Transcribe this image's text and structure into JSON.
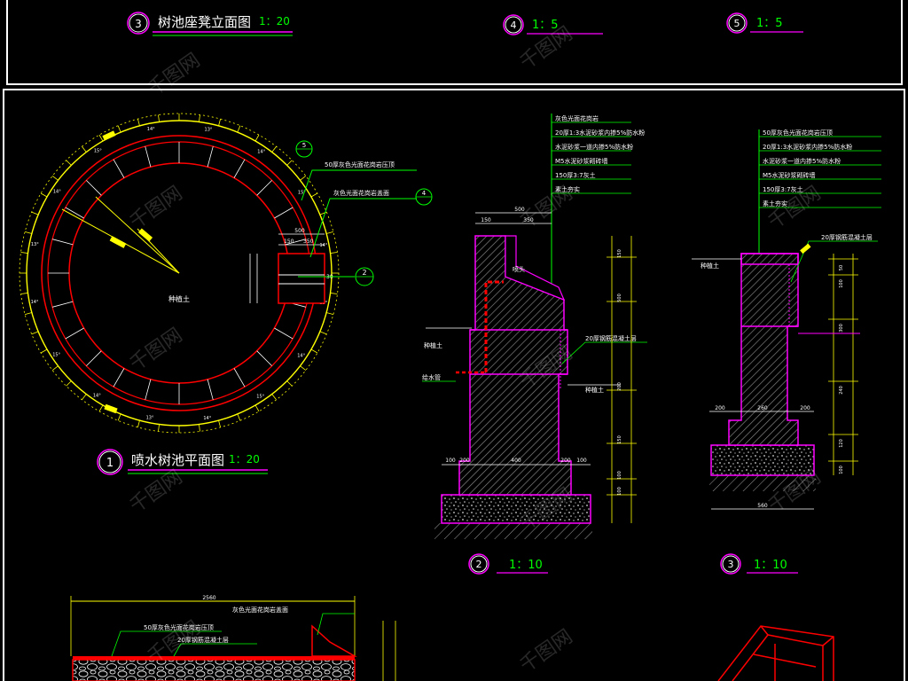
{
  "colors": {
    "background": "#000000",
    "frame": "#ffffff",
    "yellow": "#ffff00",
    "red": "#ff0000",
    "green": "#00ff00",
    "magenta": "#ff00ff",
    "cyan": "#00ffff",
    "white": "#ffffff",
    "hatch": "#8a8a8a"
  },
  "titles": {
    "top_left": {
      "number": "3",
      "text": "树池座凳立面图",
      "scale": "1：20"
    },
    "top_mid": {
      "number": "4",
      "scale": "1：5"
    },
    "top_right": {
      "number": "5",
      "scale": "1：5"
    },
    "plan": {
      "number": "1",
      "text": "喷水树池平面图",
      "scale": "1：20"
    },
    "section2": {
      "number": "2",
      "scale": "1：10"
    },
    "section3": {
      "number": "3",
      "scale": "1：10"
    }
  },
  "plan_view": {
    "center_label": "种植土",
    "leader_top": "50厚灰色光面花岗岩压顶",
    "leader_right": "灰色光面花岗岩盖面",
    "callouts": [
      "5",
      "4",
      "2"
    ],
    "dims": {
      "box_top": "500",
      "box_sub_a": "150",
      "box_sub_b": "350",
      "box_right": "30"
    },
    "ring_labels": [
      "13°",
      "14°",
      "15°",
      "14°",
      "13°",
      "14°",
      "15°",
      "14°",
      "13°",
      "14°",
      "15°",
      "14°",
      "13°",
      "14°",
      "15°",
      "14°"
    ]
  },
  "section2": {
    "notes": [
      "灰色光面花岗岩",
      "20厚1:3水泥砂浆内掺5%防水粉",
      "水泥砂浆一道内掺5%防水粉",
      "M5水泥砂浆砌砖墙",
      "150厚3:7灰土",
      "素土夯实"
    ],
    "dims_top": [
      "500",
      "150",
      "350"
    ],
    "label_nozzle": "喷头",
    "label_soil_left": "种植土",
    "label_pipe": "给水管",
    "label_rebar": "20厚钢筋混凝土层",
    "label_soil_right": "种植土",
    "dims_bottom": [
      "100",
      "200",
      "400",
      "200",
      "100"
    ],
    "dims_right": [
      "100",
      "100",
      "150",
      "200",
      "500",
      "150"
    ]
  },
  "section3": {
    "notes": [
      "50厚灰色光面花岗岩压顶",
      "20厚1:3水泥砂浆内掺5%防水粉",
      "水泥砂浆一道内掺5%防水粉",
      "M5水泥砂浆砌砖墙",
      "150厚3:7灰土",
      "素土夯实"
    ],
    "label_rebar": "20厚钢筋混凝土层",
    "label_soil": "种植土",
    "dims_mid": [
      "200",
      "260",
      "200"
    ],
    "dim_bottom": "560",
    "dims_right": [
      "50",
      "100",
      "300",
      "240",
      "120",
      "100"
    ]
  },
  "elevation": {
    "dim_total": "2560",
    "label_a": "灰色光面花岗岩盖面",
    "label_b": "50厚灰色光面花岗岩压顶",
    "label_c": "20厚钢筋混凝土层"
  },
  "watermark": "千图网"
}
